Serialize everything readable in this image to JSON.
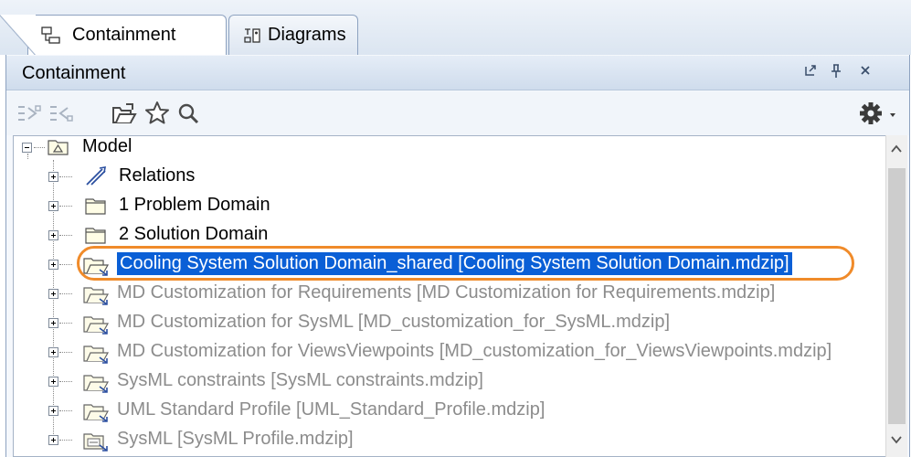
{
  "tabs": [
    {
      "label": "Containment",
      "icon": "containment-tree-icon",
      "active": true
    },
    {
      "label": "Diagrams",
      "icon": "diagrams-icon",
      "active": false
    }
  ],
  "panel": {
    "title": "Containment",
    "buttons": [
      "undock-icon",
      "pin-icon",
      "close-icon"
    ]
  },
  "toolbar": {
    "tools": [
      "collapse-all-icon",
      "expand-all-icon",
      "open-project-icon",
      "favorites-star-icon",
      "search-icon"
    ],
    "options_icon": "gear-icon"
  },
  "tree": {
    "root": {
      "label": "Model",
      "icon": "package-model-icon"
    },
    "items": [
      {
        "label": "Relations",
        "icon": "relations-icon",
        "style": "normal"
      },
      {
        "label": "1 Problem Domain",
        "icon": "package-icon",
        "style": "normal"
      },
      {
        "label": "2 Solution Domain",
        "icon": "package-icon",
        "style": "normal"
      },
      {
        "label": "Cooling System Solution Domain_shared [Cooling System Solution Domain.mdzip]",
        "icon": "shared-package-icon",
        "style": "selected"
      },
      {
        "label": "MD Customization for Requirements [MD Customization for Requirements.mdzip]",
        "icon": "used-project-icon",
        "style": "gray"
      },
      {
        "label": "MD Customization for SysML [MD_customization_for_SysML.mdzip]",
        "icon": "used-project-icon",
        "style": "gray"
      },
      {
        "label": "MD Customization for ViewsViewpoints [MD_customization_for_ViewsViewpoints.mdzip]",
        "icon": "used-project-icon",
        "style": "gray"
      },
      {
        "label": "SysML constraints [SysML constraints.mdzip]",
        "icon": "used-project-icon",
        "style": "gray"
      },
      {
        "label": "UML Standard Profile [UML_Standard_Profile.mdzip]",
        "icon": "used-project-icon",
        "style": "gray"
      },
      {
        "label": "SysML [SysML Profile.mdzip]",
        "icon": "profile-icon",
        "style": "gray"
      }
    ]
  },
  "colors": {
    "selection": "#0a5fd6",
    "highlight": "#f08b2a",
    "gray_text": "#8c8c8c"
  }
}
